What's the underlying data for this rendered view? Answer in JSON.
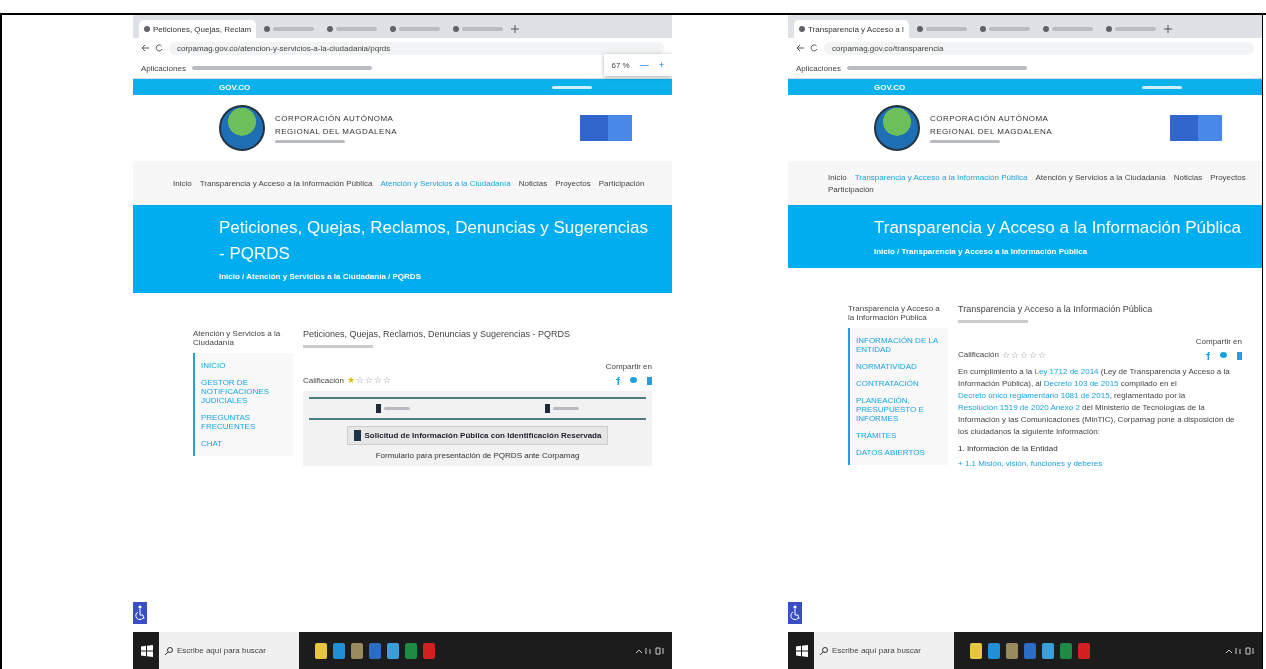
{
  "shots": [
    {
      "tabs": [
        {
          "title": "Peticiones, Quejas, Reclam",
          "selected": true
        },
        {
          "selected": false
        },
        {
          "selected": false
        },
        {
          "selected": false
        },
        {
          "selected": false
        }
      ],
      "url": "corpamag.gov.co/atencion-y-servicios-a-la-ciudadania/pqrds",
      "bookmarks": [
        "Aplicaciones"
      ],
      "zoom_popup": {
        "value": "67 %",
        "minus": "—",
        "plus": "+"
      },
      "gov_bar": "GOV.CO",
      "org_lines": [
        "CORPORACIÓN AUTÓNOMA",
        "REGIONAL DEL MAGDALENA"
      ],
      "nav": [
        {
          "label": "Inicio",
          "selected": false
        },
        {
          "label": "Transparencia y Acceso a la Información Pública",
          "selected": false
        },
        {
          "label": "Atención y Servicios a la Ciudadanía",
          "selected": true
        },
        {
          "label": "Noticias",
          "selected": false
        },
        {
          "label": "Proyectos",
          "selected": false
        },
        {
          "label": "Participación",
          "selected": false
        }
      ],
      "banner": {
        "title": "Peticiones, Quejas, Reclamos, Denuncias y Sugerencias - PQRDS",
        "breadcrumb": "Inicio / Atención y Servicios a la Ciudadanía / PQRDS"
      },
      "sidebar": {
        "heading": "Atención y Servicios a la Ciudadanía",
        "items": [
          "INICIO",
          "GESTOR DE NOTIFICACIONES JUDICIALES",
          "PREGUNTAS FRECUENTES",
          "CHAT"
        ]
      },
      "article": {
        "title": "Peticiones, Quejas, Reclamos, Denuncias y Sugerencias - PQRDS",
        "rating_label": "Calificación",
        "stars": 1,
        "share_label": "Compartir en",
        "blocks": [
          {
            "kind": "form",
            "button": "Solicitud de Información Pública con Identificación Reservada",
            "caption": "Formulario para presentación de PQRDS ante Corpamag"
          }
        ]
      },
      "taskbar": {
        "search_placeholder": "Escribe aquí para buscar"
      }
    },
    {
      "tabs": [
        {
          "title": "Transparencia y Acceso a l",
          "selected": true
        },
        {
          "selected": false
        },
        {
          "selected": false
        },
        {
          "selected": false
        },
        {
          "selected": false
        }
      ],
      "url": "corpamag.gov.co/transparencia",
      "bookmarks": [
        "Aplicaciones"
      ],
      "gov_bar": "GOV.CO",
      "org_lines": [
        "CORPORACIÓN AUTÓNOMA",
        "REGIONAL DEL MAGDALENA"
      ],
      "nav": [
        {
          "label": "Inicio",
          "selected": false
        },
        {
          "label": "Transparencia y Acceso a la Información Pública",
          "selected": true
        },
        {
          "label": "Atención y Servicios a la Ciudadanía",
          "selected": false
        },
        {
          "label": "Noticias",
          "selected": false
        },
        {
          "label": "Proyectos",
          "selected": false
        },
        {
          "label": "Participación",
          "selected": false
        }
      ],
      "banner": {
        "title": "Transparencia y Acceso a la Información Pública",
        "breadcrumb": "Inicio / Transparencia y Acceso a la Información Pública"
      },
      "sidebar": {
        "heading": "Transparencia y Acceso a la Información Pública",
        "items": [
          "INFORMACIÓN DE LA ENTIDAD",
          "NORMATIVIDAD",
          "CONTRATACIÓN",
          "PLANEACIÓN, PRESUPUESTO E INFORMES",
          "TRÁMITES",
          "DATOS ABIERTOS"
        ]
      },
      "article": {
        "title": "Transparencia y Acceso a la Información Pública",
        "rating_label": "Calificación",
        "stars": 0,
        "share_label": "Compartir en",
        "blocks": [
          {
            "kind": "paragraph",
            "segments": [
              {
                "kind": "text",
                "text": "En cumplimiento a la "
              },
              {
                "kind": "link",
                "text": "Ley 1712 de 2014"
              },
              {
                "kind": "text",
                "text": " (Ley de Transparencia y Acceso a la Información Pública), al "
              },
              {
                "kind": "link",
                "text": "Decreto 103 de 2015"
              },
              {
                "kind": "text",
                "text": " compilado en el "
              },
              {
                "kind": "link",
                "text": "Decreto único reglamentario 1081 de 2015"
              },
              {
                "kind": "text",
                "text": ", reglamentado por la "
              },
              {
                "kind": "link",
                "text": "Resolución 1519 de 2020 Anexo 2"
              },
              {
                "kind": "text",
                "text": " del Ministerio de Tecnologías de la Información y las Comunicaciones (MinTIC), Corpamag pone a disposición de los ciudadanos la siguiente información:"
              }
            ]
          },
          {
            "kind": "heading",
            "text": "1. Información de la Entidad"
          },
          {
            "kind": "link",
            "text": "+ 1.1 Misión, visión, funciones y deberes"
          }
        ]
      },
      "taskbar": {
        "search_placeholder": "Escribe aquí para buscar"
      }
    }
  ]
}
